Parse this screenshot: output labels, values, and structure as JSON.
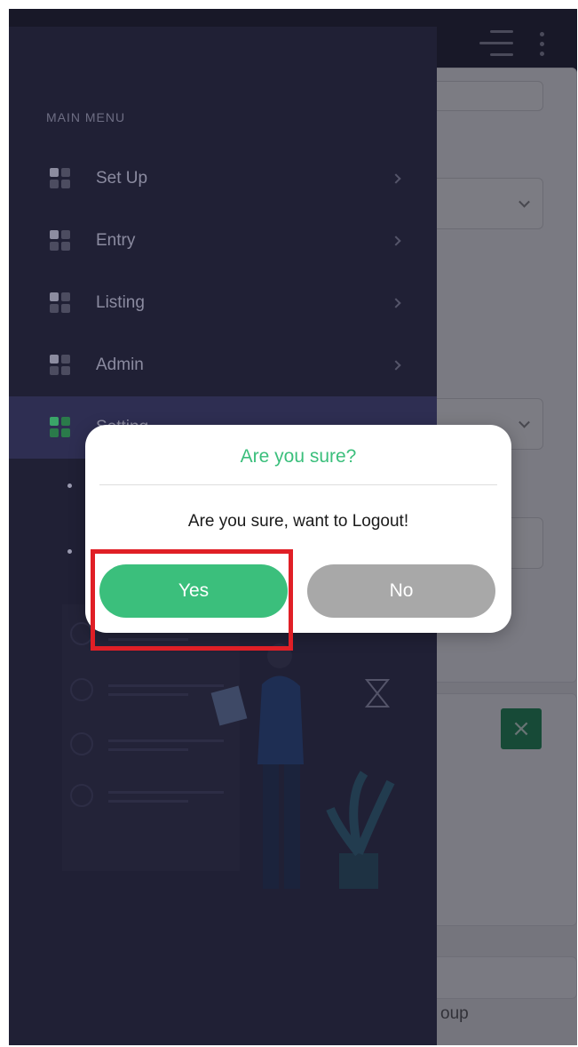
{
  "sidebar": {
    "menu_title": "MAIN MENU",
    "items": [
      {
        "label": "Set Up",
        "active": false
      },
      {
        "label": "Entry",
        "active": false
      },
      {
        "label": "Listing",
        "active": false
      },
      {
        "label": "Admin",
        "active": false
      },
      {
        "label": "Setting",
        "active": true
      }
    ]
  },
  "background": {
    "group_text": "oup",
    "close_icon": "×"
  },
  "dialog": {
    "title": "Are you sure?",
    "message": "Are you sure, want to Logout!",
    "yes_label": "Yes",
    "no_label": "No"
  },
  "colors": {
    "accent_green": "#3bbf7c",
    "sidebar_bg": "#202035",
    "highlight_red": "#e01f26"
  }
}
